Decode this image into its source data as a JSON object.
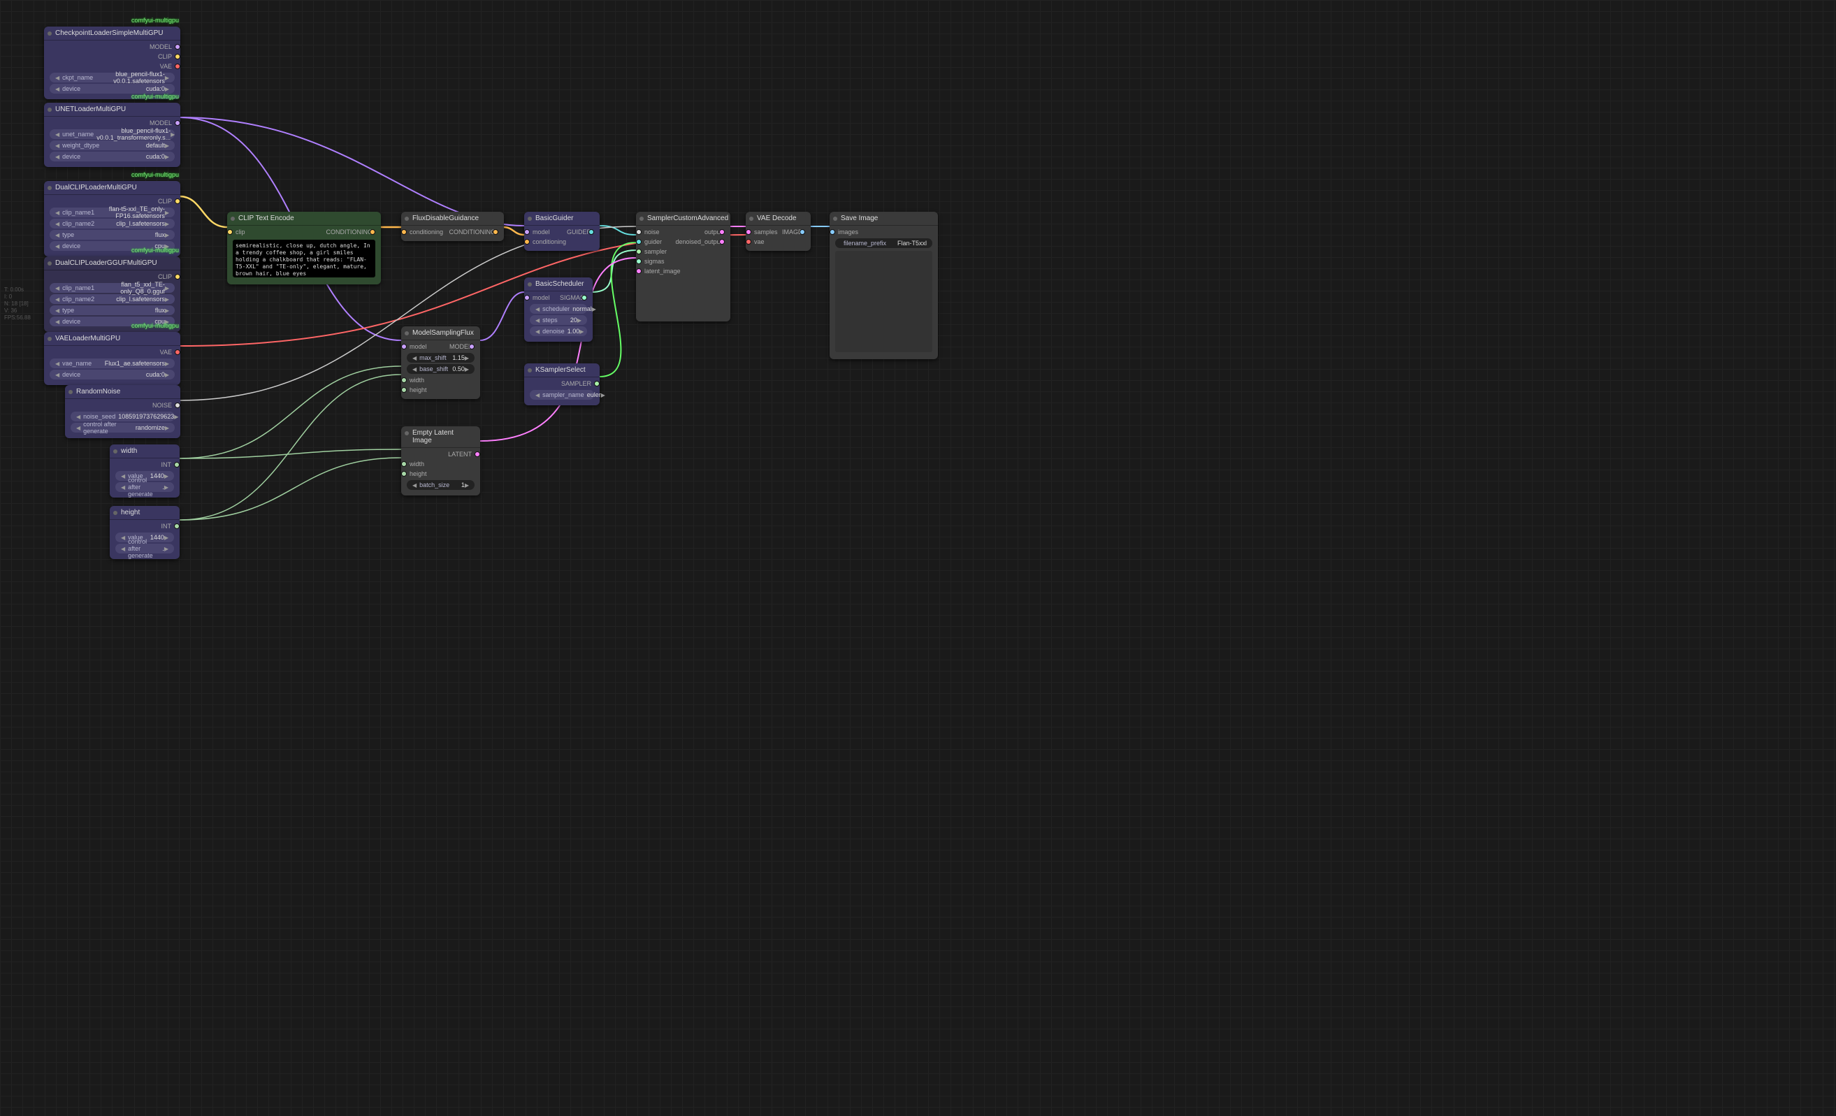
{
  "stats": {
    "l1": "T: 0.00s",
    "l2": "I: 0",
    "l3": "N: 18 [18]",
    "l4": "V: 36",
    "l5": "FPS:56.88"
  },
  "tags": {
    "multigpu": "comfyui-multigpu"
  },
  "nodes": {
    "ckpt": {
      "title": "CheckpointLoaderSimpleMultiGPU",
      "outputs": [
        "MODEL",
        "CLIP",
        "VAE"
      ],
      "widgets": [
        {
          "label": "ckpt_name",
          "value": "blue_pencil-flux1-v0.0.1.safetensors"
        },
        {
          "label": "device",
          "value": "cuda:0"
        }
      ]
    },
    "unet": {
      "title": "UNETLoaderMultiGPU",
      "outputs": [
        "MODEL"
      ],
      "widgets": [
        {
          "label": "unet_name",
          "value": "blue_pencil-flux1-v0.0.1_transformeronly.s..."
        },
        {
          "label": "weight_dtype",
          "value": "default"
        },
        {
          "label": "device",
          "value": "cuda:0"
        }
      ]
    },
    "dualclip": {
      "title": "DualCLIPLoaderMultiGPU",
      "outputs": [
        "CLIP"
      ],
      "widgets": [
        {
          "label": "clip_name1",
          "value": "flan-t5-xxl_TE_only-FP16.safetensors"
        },
        {
          "label": "clip_name2",
          "value": "clip_l.safetensors"
        },
        {
          "label": "type",
          "value": "flux"
        },
        {
          "label": "device",
          "value": "cpu"
        }
      ]
    },
    "dualclipgguf": {
      "title": "DualCLIPLoaderGGUFMultiGPU",
      "outputs": [
        "CLIP"
      ],
      "widgets": [
        {
          "label": "clip_name1",
          "value": "flan_t5_xxl_TE-only_Q8_0.gguf"
        },
        {
          "label": "clip_name2",
          "value": "clip_l.safetensors"
        },
        {
          "label": "type",
          "value": "flux"
        },
        {
          "label": "device",
          "value": "cpu"
        }
      ]
    },
    "vae": {
      "title": "VAELoaderMultiGPU",
      "outputs": [
        "VAE"
      ],
      "widgets": [
        {
          "label": "vae_name",
          "value": "Flux1_ae.safetensors"
        },
        {
          "label": "device",
          "value": "cuda:0"
        }
      ]
    },
    "noise": {
      "title": "RandomNoise",
      "outputs": [
        "NOISE"
      ],
      "widgets": [
        {
          "label": "noise_seed",
          "value": "1085919737629623"
        },
        {
          "label": "control after generate",
          "value": "randomize"
        }
      ]
    },
    "width": {
      "title": "width",
      "outputs": [
        "INT"
      ],
      "widgets": [
        {
          "label": "value",
          "value": "1440"
        },
        {
          "label": "control after generate",
          "value": "."
        }
      ]
    },
    "height": {
      "title": "height",
      "outputs": [
        "INT"
      ],
      "widgets": [
        {
          "label": "value",
          "value": "1440"
        },
        {
          "label": "control after generate",
          "value": "."
        }
      ]
    },
    "cliptext": {
      "title": "CLIP Text Encode",
      "inputs": [
        "clip"
      ],
      "outputs": [
        "CONDITIONING"
      ],
      "text": "semirealistic, close up, dutch angle, In a trendy coffee shop, a girl smiles holding a chalkboard that reads: \"FLAN-T5-XXL\" and \"TE-only\", elegant, mature, brown hair, blue eyes"
    },
    "fluxguid": {
      "title": "FluxDisableGuidance",
      "inputs": [
        "conditioning"
      ],
      "outputs": [
        "CONDITIONING"
      ]
    },
    "basicguider": {
      "title": "BasicGuider",
      "inputs": [
        "model",
        "conditioning"
      ],
      "outputs": [
        "GUIDER"
      ]
    },
    "modelsampling": {
      "title": "ModelSamplingFlux",
      "inputs": [
        "model",
        "width",
        "height"
      ],
      "outputs": [
        "MODEL"
      ],
      "widgets": [
        {
          "label": "max_shift",
          "value": "1.15"
        },
        {
          "label": "base_shift",
          "value": "0.50"
        }
      ]
    },
    "basicsched": {
      "title": "BasicScheduler",
      "inputs": [
        "model"
      ],
      "outputs": [
        "SIGMAS"
      ],
      "widgets": [
        {
          "label": "scheduler",
          "value": "normal"
        },
        {
          "label": "steps",
          "value": "20"
        },
        {
          "label": "denoise",
          "value": "1.00"
        }
      ]
    },
    "ksampsel": {
      "title": "KSamplerSelect",
      "outputs": [
        "SAMPLER"
      ],
      "widgets": [
        {
          "label": "sampler_name",
          "value": "euler"
        }
      ]
    },
    "emptylatent": {
      "title": "Empty Latent Image",
      "inputs": [
        "width",
        "height"
      ],
      "outputs": [
        "LATENT"
      ],
      "widgets": [
        {
          "label": "batch_size",
          "value": "1"
        }
      ]
    },
    "samplercustom": {
      "title": "SamplerCustomAdvanced",
      "inputs": [
        "noise",
        "guider",
        "sampler",
        "sigmas",
        "latent_image"
      ],
      "outputs": [
        {
          "label": "output",
          "sub": ""
        },
        {
          "label": "denoised_output",
          "sub": ""
        }
      ]
    },
    "vaedecode": {
      "title": "VAE Decode",
      "inputs": [
        "samples",
        "vae"
      ],
      "outputs": [
        "IMAGE"
      ]
    },
    "saveimage": {
      "title": "Save Image",
      "inputs": [
        "images"
      ],
      "widgets": [
        {
          "label": "filename_prefix",
          "value": "Flan-T5xxl"
        }
      ]
    }
  }
}
